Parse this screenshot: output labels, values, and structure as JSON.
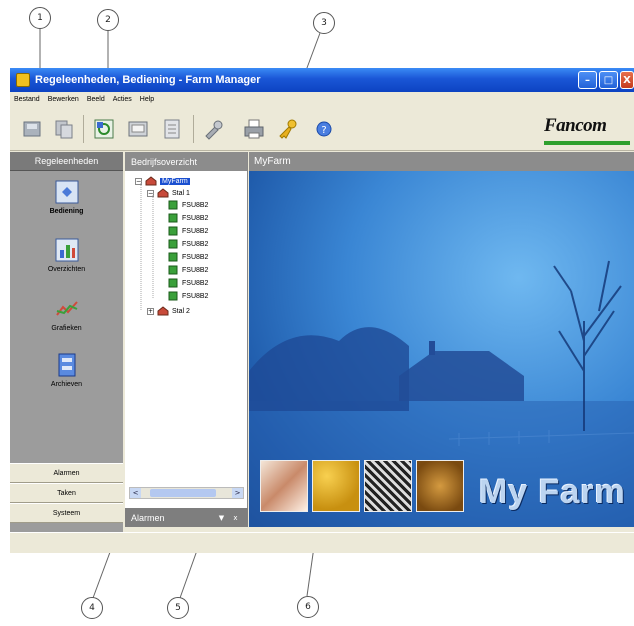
{
  "window": {
    "title": "Regeleenheden, Bediening - Farm Manager",
    "buttons": {
      "minimize": "–",
      "maximize": "□",
      "close": "X"
    }
  },
  "menu": [
    "Bestand",
    "Bewerken",
    "Beeld",
    "Acties",
    "Help"
  ],
  "toolbar": {
    "icons": [
      "save-icon",
      "copy-icon",
      "sync-icon",
      "screen-icon",
      "report-icon",
      "tools-icon",
      "print-icon",
      "keys-icon",
      "help-icon"
    ],
    "logo": "Fancom"
  },
  "left_panel": {
    "header": "Regeleenheden",
    "items": [
      {
        "label": "Bediening",
        "icon": "control-icon",
        "active": true
      },
      {
        "label": "Overzichten",
        "icon": "overview-icon",
        "active": false
      },
      {
        "label": "Grafieken",
        "icon": "graph-icon",
        "active": false
      },
      {
        "label": "Archieven",
        "icon": "archive-icon",
        "active": false
      }
    ],
    "tabs": [
      "Alarmen",
      "Taken",
      "Systeem"
    ]
  },
  "tree_panel": {
    "header": "Bedrijfsoverzicht",
    "root": "MyFarm",
    "stal1": "Stal 1",
    "devices": [
      "FSU8B2",
      "FSU8B2",
      "FSU8B2",
      "FSU8B2",
      "FSU8B2",
      "FSU8B2",
      "FSU8B2",
      "FSU8B2"
    ],
    "stal2": "Stal 2",
    "expand_minus": "−",
    "expand_plus": "+",
    "scroll_left": "<",
    "scroll_right": ">"
  },
  "alarm_bar": {
    "title": "Alarmen",
    "btn1": "▼",
    "btn2": "x"
  },
  "main": {
    "header": "MyFarm",
    "splash_title": "My Farm"
  },
  "callouts": [
    "1",
    "2",
    "3",
    "4",
    "5",
    "6"
  ]
}
